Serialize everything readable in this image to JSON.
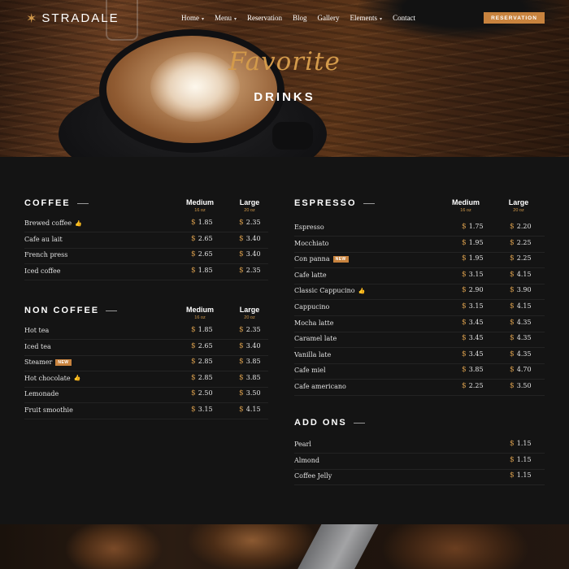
{
  "brand": {
    "name": "STRADALE",
    "star_icon": "star-icon"
  },
  "nav": {
    "items": [
      {
        "label": "Home",
        "caret": true
      },
      {
        "label": "Menu",
        "caret": true
      },
      {
        "label": "Reservation",
        "caret": false
      },
      {
        "label": "Blog",
        "caret": false
      },
      {
        "label": "Gallery",
        "caret": false
      },
      {
        "label": "Elements",
        "caret": true
      },
      {
        "label": "Contact",
        "caret": false
      }
    ],
    "cta_label": "RESERVATION"
  },
  "hero": {
    "script_title": "Favorite",
    "title": "DRINKS"
  },
  "colors": {
    "accent": "#d39a4b",
    "button": "#c8833e",
    "background": "#141414"
  },
  "sections": {
    "coffee": {
      "title": "COFFEE",
      "col1": {
        "label": "Medium",
        "oz": "16 oz"
      },
      "col2": {
        "label": "Large",
        "oz": "20 oz"
      },
      "items": [
        {
          "name": "Brewed coffee",
          "tag": "thumb",
          "p1": "1.85",
          "p2": "2.35"
        },
        {
          "name": "Cafe au lait",
          "tag": "",
          "p1": "2.65",
          "p2": "3.40"
        },
        {
          "name": "French press",
          "tag": "",
          "p1": "2.65",
          "p2": "3.40"
        },
        {
          "name": "Iced coffee",
          "tag": "",
          "p1": "1.85",
          "p2": "2.35"
        }
      ]
    },
    "non_coffee": {
      "title": "NON COFFEE",
      "col1": {
        "label": "Medium",
        "oz": "16 oz"
      },
      "col2": {
        "label": "Large",
        "oz": "20 oz"
      },
      "items": [
        {
          "name": "Hot tea",
          "tag": "",
          "p1": "1.85",
          "p2": "2.35"
        },
        {
          "name": "Iced tea",
          "tag": "",
          "p1": "2.65",
          "p2": "3.40"
        },
        {
          "name": "Steamer",
          "tag": "NEW",
          "p1": "2.85",
          "p2": "3.85"
        },
        {
          "name": "Hot chocolate",
          "tag": "thumb",
          "p1": "2.85",
          "p2": "3.85"
        },
        {
          "name": "Lemonade",
          "tag": "",
          "p1": "2.50",
          "p2": "3.50"
        },
        {
          "name": "Fruit smoothie",
          "tag": "",
          "p1": "3.15",
          "p2": "4.15"
        }
      ]
    },
    "espresso": {
      "title": "ESPRESSO",
      "col1": {
        "label": "Medium",
        "oz": "16 oz"
      },
      "col2": {
        "label": "Large",
        "oz": "20 oz"
      },
      "items": [
        {
          "name": "Espresso",
          "tag": "",
          "p1": "1.75",
          "p2": "2.20"
        },
        {
          "name": "Mocchiato",
          "tag": "",
          "p1": "1.95",
          "p2": "2.25"
        },
        {
          "name": "Con panna",
          "tag": "NEW",
          "p1": "1.95",
          "p2": "2.25"
        },
        {
          "name": "Cafe latte",
          "tag": "",
          "p1": "3.15",
          "p2": "4.15"
        },
        {
          "name": "Classic Cappucino",
          "tag": "thumb",
          "p1": "2.90",
          "p2": "3.90"
        },
        {
          "name": "Cappucino",
          "tag": "",
          "p1": "3.15",
          "p2": "4.15"
        },
        {
          "name": "Mocha latte",
          "tag": "",
          "p1": "3.45",
          "p2": "4.35"
        },
        {
          "name": "Caramel late",
          "tag": "",
          "p1": "3.45",
          "p2": "4.35"
        },
        {
          "name": "Vanilla late",
          "tag": "",
          "p1": "3.45",
          "p2": "4.35"
        },
        {
          "name": "Cafe miel",
          "tag": "",
          "p1": "3.85",
          "p2": "4.70"
        },
        {
          "name": "Cafe americano",
          "tag": "",
          "p1": "2.25",
          "p2": "3.50"
        }
      ]
    },
    "add_ons": {
      "title": "ADD ONS",
      "items": [
        {
          "name": "Pearl",
          "tag": "",
          "p1": "1.15"
        },
        {
          "name": "Almond",
          "tag": "",
          "p1": "1.15"
        },
        {
          "name": "Coffee Jelly",
          "tag": "",
          "p1": "1.15"
        }
      ]
    }
  },
  "currency_symbol": "$",
  "new_badge_label": "NEW",
  "thumb_icon": "thumbs-up-icon"
}
